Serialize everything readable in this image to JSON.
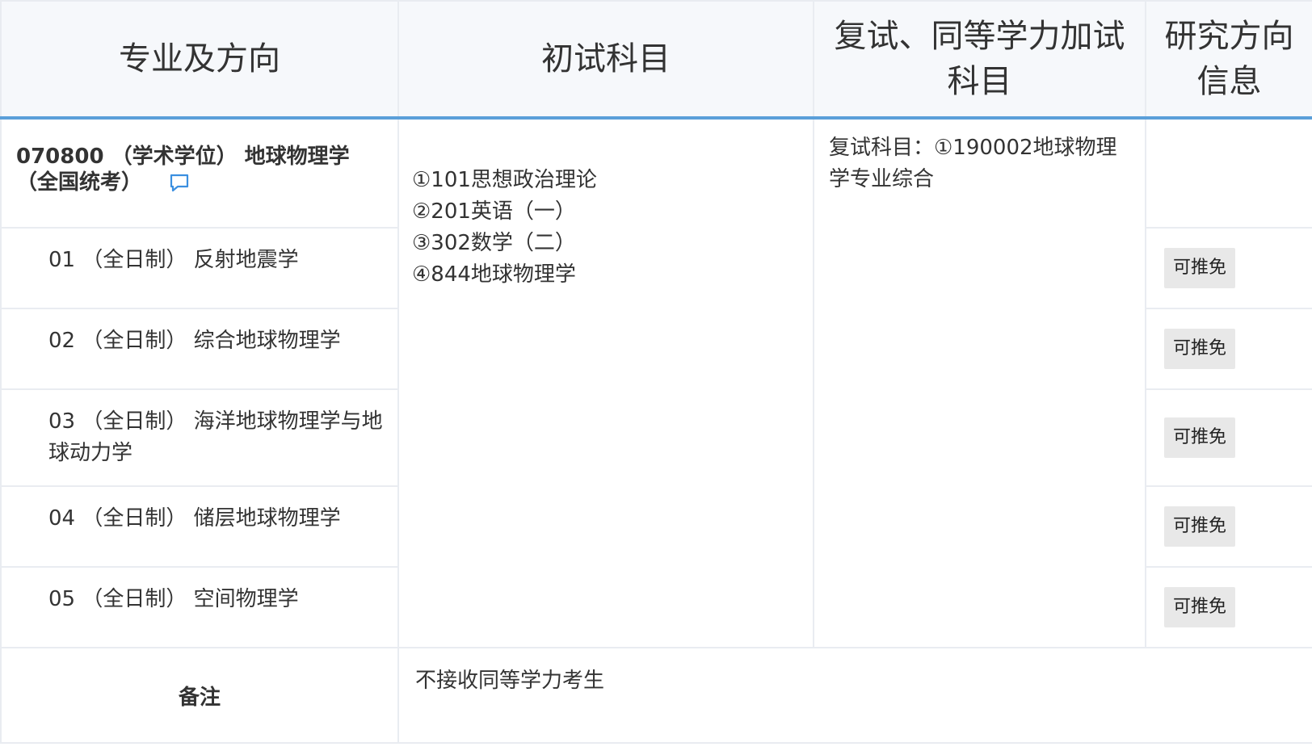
{
  "header": {
    "major": "专业及方向",
    "initial_subjects": "初试科目",
    "retest_subjects_line1": "复试、同等学力加试",
    "retest_subjects_line2": "科目",
    "research_line1": "研究方向",
    "research_line2": "信息"
  },
  "major": {
    "title_line1": "070800 （学术学位） 地球物理学",
    "title_line2": "（全国统考）",
    "comment_icon": "comment-icon",
    "accent_color": "#3b8fe0"
  },
  "initial_subjects": [
    "①101思想政治理论",
    "②201英语（一）",
    "③302数学（二）",
    "④844地球物理学"
  ],
  "retest_subjects": "复试科目：①190002地球物理学专业综合",
  "directions": [
    {
      "label": "01 （全日制） 反射地震学",
      "tag": "可推免"
    },
    {
      "label": "02 （全日制） 综合地球物理学",
      "tag": "可推免"
    },
    {
      "label": "03 （全日制） 海洋地球物理学与地球动力学",
      "tag": "可推免"
    },
    {
      "label": "04 （全日制） 储层地球物理学",
      "tag": "可推免"
    },
    {
      "label": "05 （全日制） 空间物理学",
      "tag": "可推免"
    }
  ],
  "note": {
    "label": "备注",
    "text": "不接收同等学力考生"
  },
  "colors": {
    "header_bg": "#f6f8fb",
    "header_underline": "#5b9fd9",
    "tag_bg": "#e8e8e8",
    "border": "#e9ecf1"
  }
}
